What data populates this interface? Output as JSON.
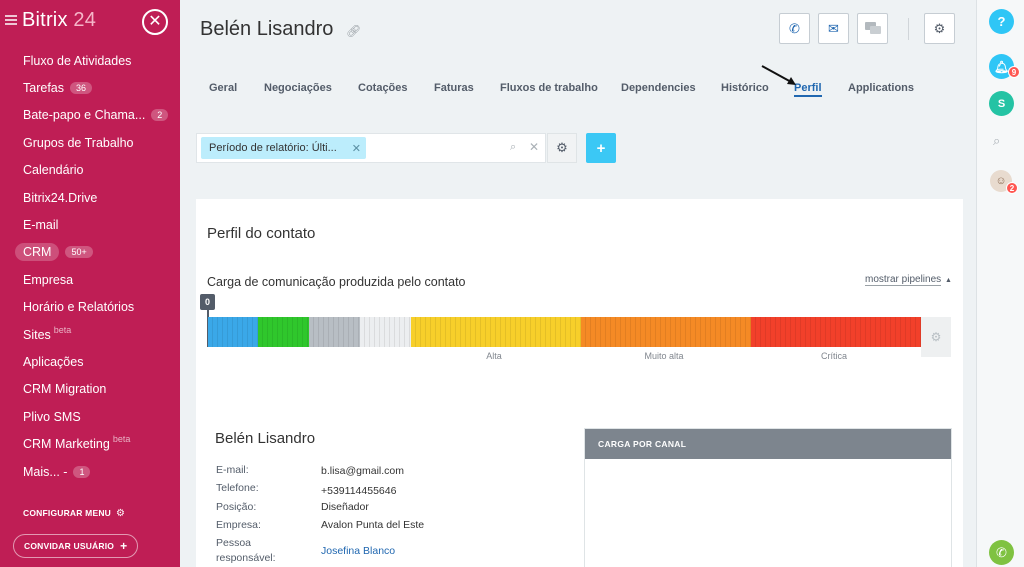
{
  "sidebar": {
    "brand_name": "Bitrix",
    "brand_num": "24",
    "close_label": "✕",
    "items": [
      {
        "label": "Fluxo de Atividades"
      },
      {
        "label": "Tarefas",
        "badge": "36"
      },
      {
        "label": "Bate-papo e Chama...",
        "badge": "2"
      },
      {
        "label": "Grupos de Trabalho"
      },
      {
        "label": "Calendário"
      },
      {
        "label": "Bitrix24.Drive"
      },
      {
        "label": "E-mail"
      },
      {
        "label": "CRM",
        "badge": "50+"
      },
      {
        "label": "Empresa"
      },
      {
        "label": "Horário e Relatórios"
      },
      {
        "label": "Sites",
        "beta": "beta"
      },
      {
        "label": "Aplicações"
      },
      {
        "label": "CRM Migration"
      },
      {
        "label": "Plivo SMS"
      },
      {
        "label": "CRM Marketing",
        "beta": "beta"
      },
      {
        "label": "Mais... -",
        "badge": "1"
      }
    ],
    "configure_menu": "CONFIGURAR MENU",
    "invite_user": "CONVIDAR USUÁRIO"
  },
  "right_panel": {
    "help": "?",
    "notifications_count": "9",
    "people_count": "2"
  },
  "header": {
    "title": "Belén Lisandro"
  },
  "tabs": [
    {
      "label": "Geral"
    },
    {
      "label": "Negociações"
    },
    {
      "label": "Cotações"
    },
    {
      "label": "Faturas"
    },
    {
      "label": "Fluxos de trabalho"
    },
    {
      "label": "Dependencies"
    },
    {
      "label": "Histórico"
    },
    {
      "label": "Perfil",
      "active": true
    },
    {
      "label": "Applications"
    }
  ],
  "filter": {
    "chip": "Período de relatório: Últi..."
  },
  "profile": {
    "title": "Perfil do contato",
    "load_title": "Carga de comunicação produzida pelo contato",
    "show_pipelines": "mostrar pipelines",
    "marker_value": "0",
    "bar_labels": [
      "Alta",
      "Muito alta",
      "Crítica"
    ],
    "bar_colors": [
      "#3aa8e8",
      "#2fc72c",
      "#b8bec4",
      "#eceef0",
      "#f7cf2a",
      "#f58a25",
      "#f2402a"
    ],
    "person": {
      "name": "Belén Lisandro",
      "fields": [
        {
          "label": "E-mail:",
          "value": "b.lisa@gmail.com"
        },
        {
          "label": "Telefone:",
          "value": "+539114455646"
        },
        {
          "label": "Posição:",
          "value": "Diseñador"
        },
        {
          "label": "Empresa:",
          "value": "Avalon Punta del Este"
        },
        {
          "label": "Pessoa",
          "label2": "responsável:",
          "value": "Josefina Blanco"
        }
      ]
    },
    "channel_title": "CARGA POR CANAL"
  }
}
